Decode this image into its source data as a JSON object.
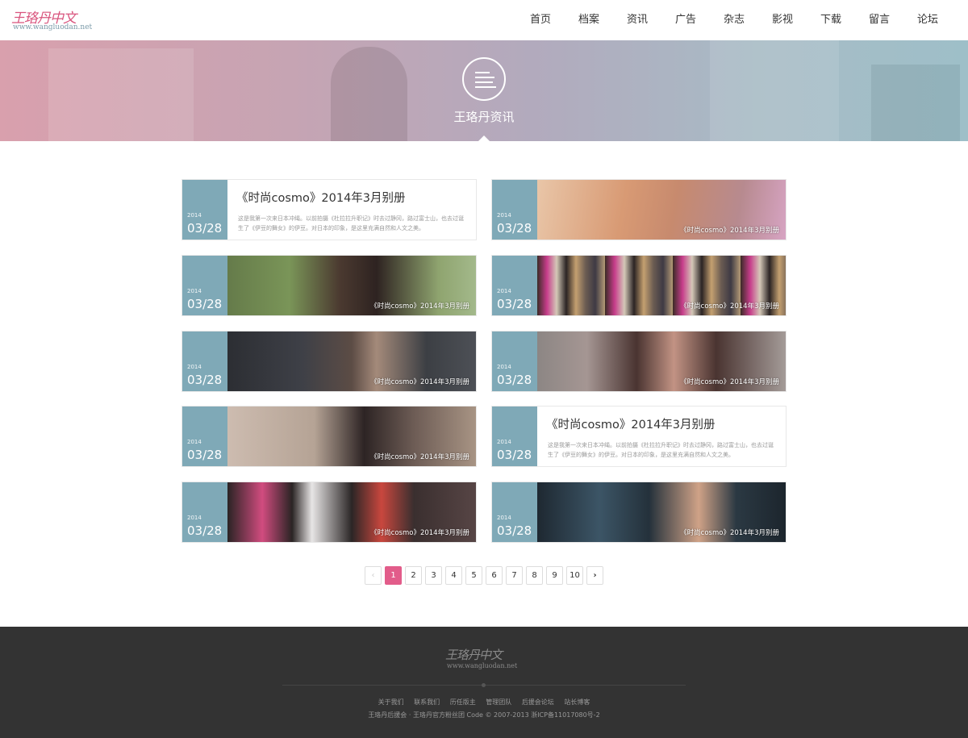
{
  "header": {
    "logo_main": "王珞丹中文",
    "logo_sub": "www.wangluodan.net",
    "nav": [
      "首页",
      "档案",
      "资讯",
      "广告",
      "杂志",
      "影视",
      "下载",
      "留言",
      "论坛"
    ]
  },
  "banner": {
    "title": "王珞丹资讯",
    "icon": "list-lines-icon"
  },
  "cards": [
    {
      "year": "2014",
      "day": "03/28",
      "title": "《时尚cosmo》2014年3月别册",
      "desc": "这是我第一次来日本冲绳。以前拍摄《杜拉拉升职记》时去过静冈，路过富士山，也去过诞生了《伊豆的舞女》的伊豆。对日本的印象，是这里充满自然和人文之美。"
    },
    {
      "year": "2014",
      "day": "03/28",
      "caption": "《时尚cosmo》2014年3月别册"
    },
    {
      "year": "2014",
      "day": "03/28",
      "caption": "《时尚cosmo》2014年3月别册"
    },
    {
      "year": "2014",
      "day": "03/28",
      "caption": "《时尚cosmo》2014年3月别册"
    },
    {
      "year": "2014",
      "day": "03/28",
      "caption": "《时尚cosmo》2014年3月别册"
    },
    {
      "year": "2014",
      "day": "03/28",
      "caption": "《时尚cosmo》2014年3月别册"
    },
    {
      "year": "2014",
      "day": "03/28",
      "caption": "《时尚cosmo》2014年3月别册"
    },
    {
      "year": "2014",
      "day": "03/28",
      "title": "《时尚cosmo》2014年3月别册",
      "desc": "这是我第一次来日本冲绳。以前拍摄《杜拉拉升职记》时去过静冈，路过富士山，也去过诞生了《伊豆的舞女》的伊豆。对日本的印象，是这里充满自然和人文之美。"
    },
    {
      "year": "2014",
      "day": "03/28",
      "caption": "《时尚cosmo》2014年3月别册"
    },
    {
      "year": "2014",
      "day": "03/28",
      "caption": "《时尚cosmo》2014年3月别册"
    }
  ],
  "pagination": {
    "prev": "‹",
    "next": "›",
    "pages": [
      "1",
      "2",
      "3",
      "4",
      "5",
      "6",
      "7",
      "8",
      "9",
      "10"
    ],
    "current": "1"
  },
  "footer": {
    "logo_main": "王珞丹中文",
    "logo_sub": "www.wangluodan.net",
    "links": [
      "关于我们",
      "联系我们",
      "历任版主",
      "管理团队",
      "后援会论坛",
      "站长博客"
    ],
    "copyright": "王珞丹后援会 · 王珞丹官方粉丝团 Code © 2007-2013 浙ICP备11017080号-2"
  },
  "colors": {
    "accent": "#e25c8a",
    "date_box": "#7fa9b7",
    "footer_bg": "#333333"
  }
}
